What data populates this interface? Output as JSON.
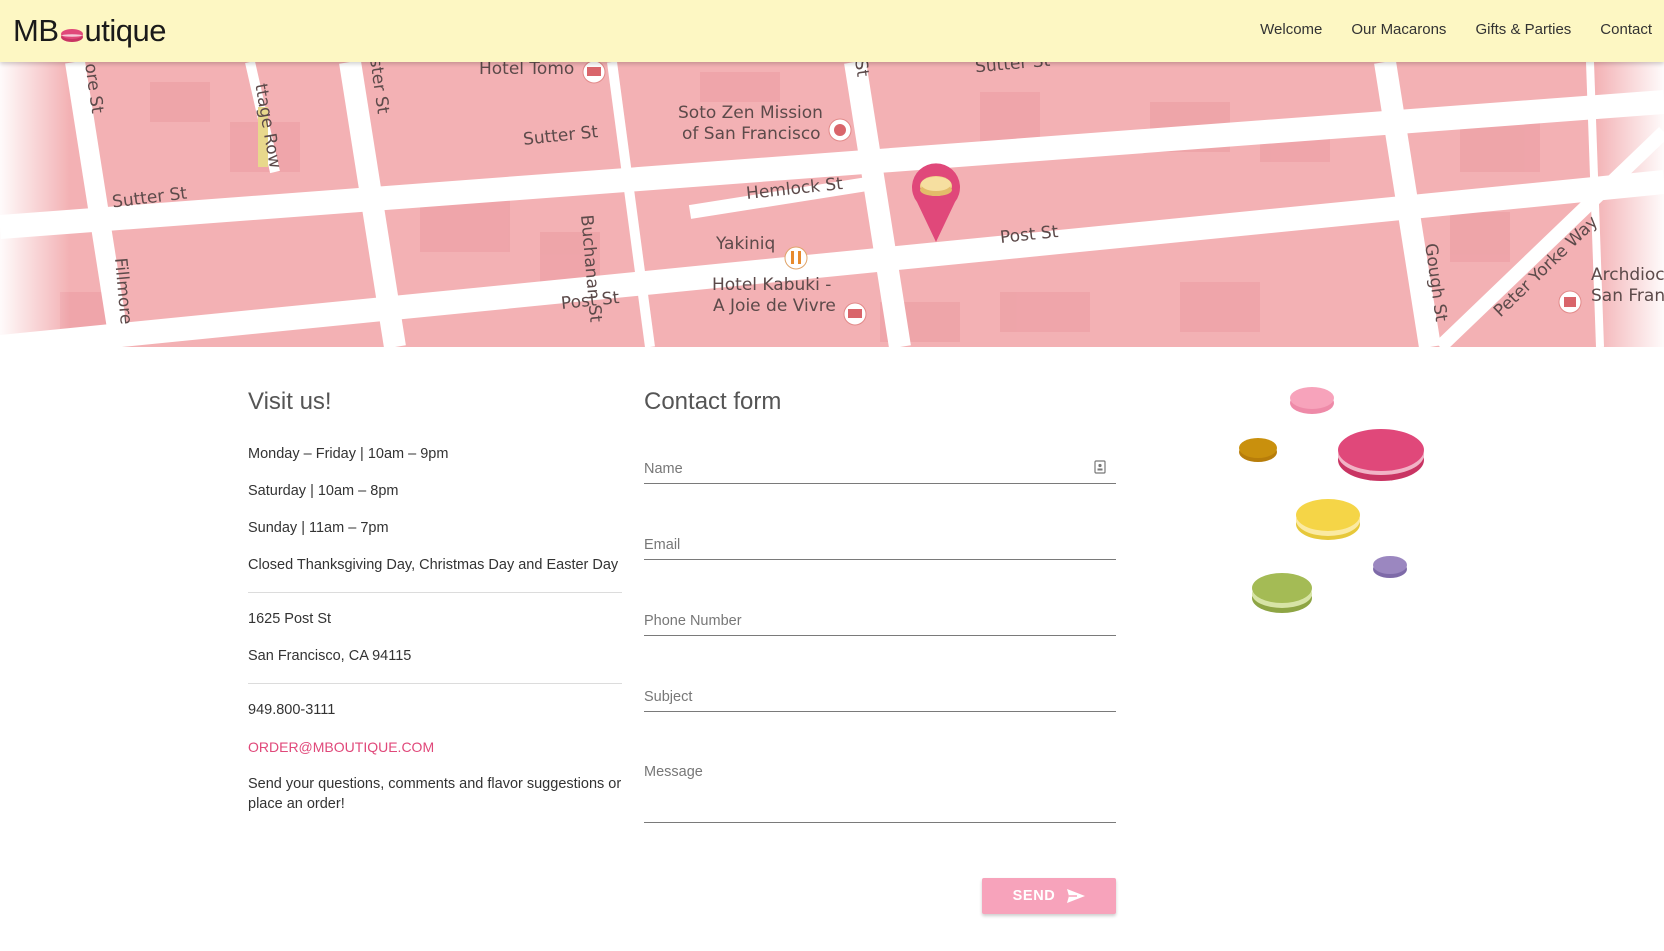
{
  "brand": {
    "logo_prefix": "MB",
    "logo_suffix": "utique"
  },
  "nav": [
    {
      "label": "Welcome"
    },
    {
      "label": "Our Macarons"
    },
    {
      "label": "Gifts & Parties"
    },
    {
      "label": "Contact"
    }
  ],
  "map": {
    "labels": {
      "hotel_tomo": "Hotel Tomo",
      "sutter_a": "Sutter St",
      "sutter_b": "Sutter St",
      "sutter_c": "Sutter St",
      "soto_zen_1": "Soto Zen Mission",
      "soto_zen_2": "of San Francisco",
      "hemlock": "Hemlock St",
      "buchanan": "Buchanan St",
      "yakiniq": "Yakiniq",
      "post_a": "Post St",
      "post_b": "Post St",
      "hotel_kabuki_1": "Hotel Kabuki -",
      "hotel_kabuki_2": "A Joie de Vivre",
      "fillmore": "Fillmore",
      "cottage_row": "ttage Row",
      "webster": "ster St",
      "gough": "Gough St",
      "peter_yorke": "Peter Yorke Way",
      "archdiocese_1": "Archdioc",
      "archdiocese_2": "San Fran",
      "ore_st": "ore St",
      "st_top": "St"
    },
    "accent_pin": "#e0487a"
  },
  "visit": {
    "title": "Visit us!",
    "hours": [
      "Monday – Friday | 10am – 9pm",
      "Saturday | 10am – 8pm",
      "Sunday | 11am – 7pm",
      "Closed Thanksgiving Day, Christmas Day and Easter Day"
    ],
    "address": [
      "1625 Post St",
      "San Francisco, CA 94115"
    ],
    "phone": "949.800-3111",
    "email": "ORDER@MBOUTIQUE.COM",
    "note": "Send your questions, comments and flavor suggestions or place an order!"
  },
  "contact_form": {
    "title": "Contact form",
    "fields": {
      "name": "Name",
      "email": "Email",
      "phone": "Phone Number",
      "subject": "Subject",
      "message": "Message"
    },
    "send_label": "SEND",
    "icons": {
      "name_field": "contact-card-icon",
      "send": "send-arrow-icon"
    }
  },
  "colors": {
    "header_bg": "#fdf7c3",
    "accent": "#e0487a",
    "send_button": "#f7a3bb",
    "map_block": "#f3b1b4",
    "map_road": "#ffffff"
  }
}
